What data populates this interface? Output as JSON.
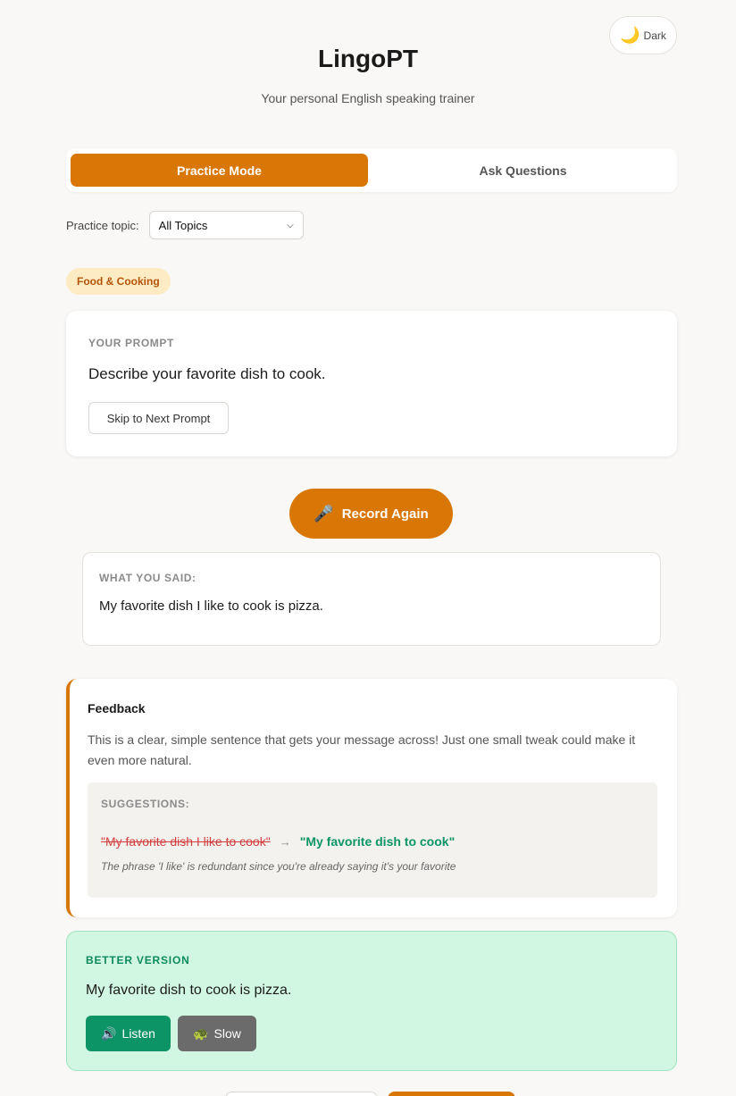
{
  "theme_toggle": {
    "icon": "moon-icon",
    "glyph": "🌙",
    "label": "Dark"
  },
  "header": {
    "title": "LingoPT",
    "subtitle": "Your personal English speaking trainer"
  },
  "tabs": [
    {
      "label": "Practice Mode",
      "active": true
    },
    {
      "label": "Ask Questions",
      "active": false
    }
  ],
  "topic": {
    "label": "Practice topic:",
    "selected": "All Topics"
  },
  "category_badge": "Food & Cooking",
  "prompt": {
    "heading": "YOUR PROMPT",
    "text": "Describe your favorite dish to cook.",
    "skip_label": "Skip to Next Prompt"
  },
  "record": {
    "icon": "microphone-icon",
    "glyph": "🎤",
    "label": "Record Again"
  },
  "transcript": {
    "heading": "WHAT YOU SAID:",
    "text": "My favorite dish I like to cook is pizza."
  },
  "feedback": {
    "title": "Feedback",
    "body": "This is a clear, simple sentence that gets your message across! Just one small tweak could make it even more natural.",
    "suggestions_heading": "SUGGESTIONS:",
    "suggestion": {
      "original": "\"My favorite dish I like to cook\"",
      "arrow": "→",
      "improved": "\"My favorite dish to cook\"",
      "note": "The phrase 'I like' is redundant since you're already saying it's your favorite"
    }
  },
  "better_version": {
    "heading": "BETTER VERSION",
    "text": "My favorite dish to cook is pizza.",
    "listen": {
      "icon": "speaker-icon",
      "glyph": "🔊",
      "label": "Listen"
    },
    "slow": {
      "icon": "turtle-icon",
      "glyph": "🐢",
      "label": "Slow"
    }
  },
  "colors": {
    "accent": "#d97706",
    "success": "#0c9467",
    "error": "#d23f3f",
    "background": "#f9f8f6"
  }
}
